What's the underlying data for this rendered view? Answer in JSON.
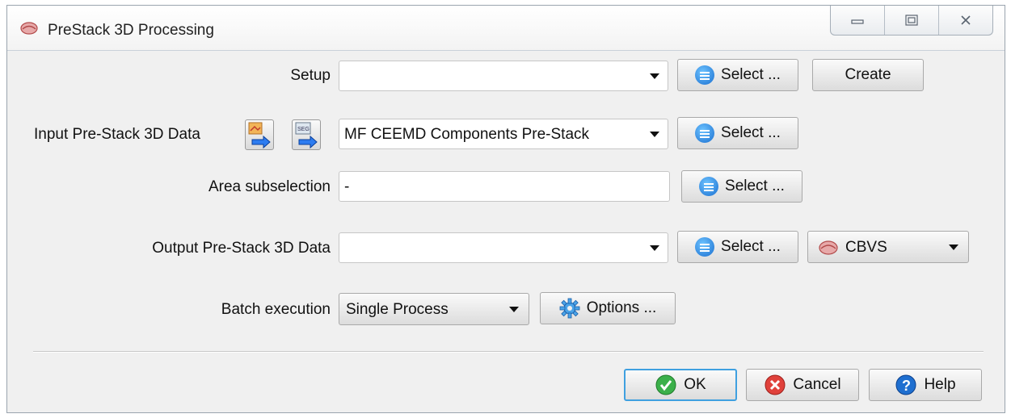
{
  "window": {
    "title": "PreStack 3D Processing"
  },
  "setup": {
    "label": "Setup",
    "value": "",
    "select_label": "Select ...",
    "create_label": "Create"
  },
  "input": {
    "label": "Input Pre-Stack 3D Data",
    "value": "MF CEEMD Components Pre-Stack",
    "select_label": "Select ..."
  },
  "area": {
    "label": "Area subselection",
    "value": "-",
    "select_label": "Select ..."
  },
  "output": {
    "label": "Output Pre-Stack 3D Data",
    "value": "",
    "select_label": "Select ...",
    "format": "CBVS"
  },
  "batch": {
    "label": "Batch execution",
    "value": "Single Process",
    "options_label": "Options ..."
  },
  "footer": {
    "ok_label": "OK",
    "cancel_label": "Cancel",
    "help_label": "Help"
  }
}
